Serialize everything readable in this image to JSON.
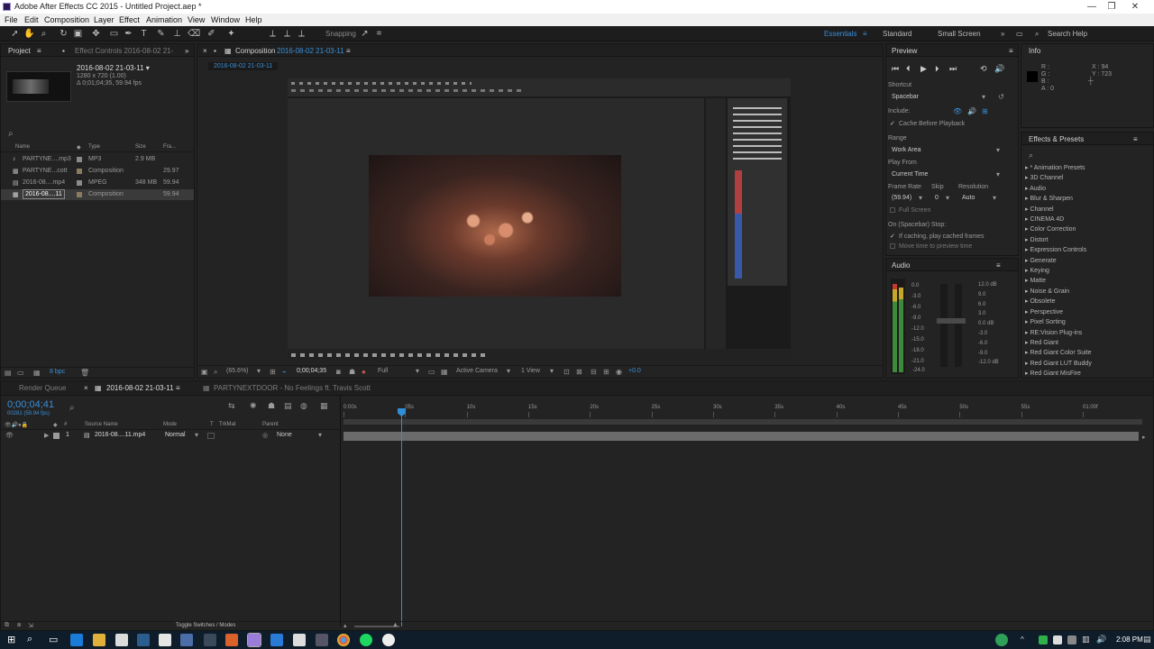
{
  "window": {
    "title": "Adobe After Effects CC 2015 - Untitled Project.aep *"
  },
  "menu": [
    "File",
    "Edit",
    "Composition",
    "Layer",
    "Effect",
    "Animation",
    "View",
    "Window",
    "Help"
  ],
  "toolbar": {
    "snapping": "Snapping",
    "workspaces": [
      "Essentials",
      "Standard",
      "Small Screen"
    ],
    "search": "Search Help"
  },
  "project": {
    "tab": "Project",
    "effect_controls": "Effect Controls 2016-08-02 21-",
    "selected_name": "2016-08-02 21-03-11 ▾",
    "selected_dims": "1280 x 720 (1.00)",
    "selected_dur": "Δ 0;01;04;35, 59.94 fps",
    "columns": [
      "Name",
      "Type",
      "Size",
      "Fra..."
    ],
    "items": [
      {
        "name": "PARTYNE....mp3",
        "type": "MP3",
        "size": "2.9 MB",
        "fps": ""
      },
      {
        "name": "PARTYNE...cott",
        "type": "Composition",
        "size": "",
        "fps": "29.97"
      },
      {
        "name": "2016-08....mp4",
        "type": "MPEG",
        "size": "348 MB",
        "fps": "59.94"
      },
      {
        "name": "2016-08....11",
        "type": "Composition",
        "size": "",
        "fps": "59.94"
      }
    ],
    "bpc": "8 bpc"
  },
  "composition": {
    "tab_label": "Composition",
    "tab_name": "2016-08-02 21-03-11",
    "tag": "2016-08-02 21-03-11",
    "zoom": "(65.6%)",
    "time": "0;00;04;35",
    "quality": "Full",
    "camera": "Active Camera",
    "view": "1 View",
    "exposure": "+0.0"
  },
  "preview": {
    "title": "Preview",
    "shortcut_label": "Shortcut",
    "shortcut": "Spacebar",
    "include_label": "Include:",
    "cache": "Cache Before Playback",
    "range_label": "Range",
    "range": "Work Area",
    "play_from_label": "Play From",
    "play_from": "Current Time",
    "frame_rate_label": "Frame Rate",
    "skip_label": "Skip",
    "resolution_label": "Resolution",
    "frame_rate": "(59.94)",
    "skip": "0",
    "resolution": "Auto",
    "full_screen": "Full Screen",
    "stop_label": "On (Spacebar) Stop:",
    "if_caching": "If caching, play cached frames",
    "move_time": "Move time to preview time"
  },
  "info": {
    "title": "Info",
    "r": "R :",
    "g": "G :",
    "b": "B :",
    "a": "A : 0",
    "x": "X : 94",
    "y": "Y : 723"
  },
  "audio": {
    "title": "Audio",
    "left_scale": [
      "0.0",
      "-3.0",
      "-6.0",
      "-9.0",
      "-12.0",
      "-15.0",
      "-18.0",
      "-21.0",
      "-24.0"
    ],
    "right_scale": [
      "12.0 dB",
      "9.0",
      "6.0",
      "3.0",
      "0.0 dB",
      "-3.0",
      "-6.0",
      "-9.0",
      "-12.0 dB"
    ]
  },
  "effects": {
    "title": "Effects & Presets",
    "items": [
      "* Animation Presets",
      "3D Channel",
      "Audio",
      "Blur & Sharpen",
      "Channel",
      "CINEMA 4D",
      "Color Correction",
      "Distort",
      "Expression Controls",
      "Generate",
      "Keying",
      "Matte",
      "Noise & Grain",
      "Obsolete",
      "Perspective",
      "Pixel Sorting",
      "RE:Vision Plug-ins",
      "Red Giant",
      "Red Giant Color Suite",
      "Red Giant LUT Buddy",
      "Red Giant MisFire"
    ]
  },
  "timeline": {
    "render_queue": "Render Queue",
    "tab1": "2016-08-02 21-03-11",
    "tab2": "PARTYNEXTDOOR - No Feelings ft. Travis Scott",
    "time": "0;00;04;41",
    "frames": "00281 (59.94 fps)",
    "columns": [
      "Source Name",
      "Mode",
      "T",
      "TrkMat",
      "Parent"
    ],
    "layer": {
      "num": "1",
      "name": "2016-08....11.mp4",
      "mode": "Normal",
      "parent": "None"
    },
    "ruler": [
      "0:00s",
      "05s",
      "10s",
      "15s",
      "20s",
      "25s",
      "30s",
      "35s",
      "40s",
      "45s",
      "50s",
      "55s",
      "01:00f"
    ],
    "toggle": "Toggle Switches / Modes"
  },
  "taskbar": {
    "time": "2:08 PM"
  },
  "colors": {
    "accent": "#2d8ceb",
    "playhead": "#2f8fd6",
    "layer_bar": "#6b6b6b"
  }
}
